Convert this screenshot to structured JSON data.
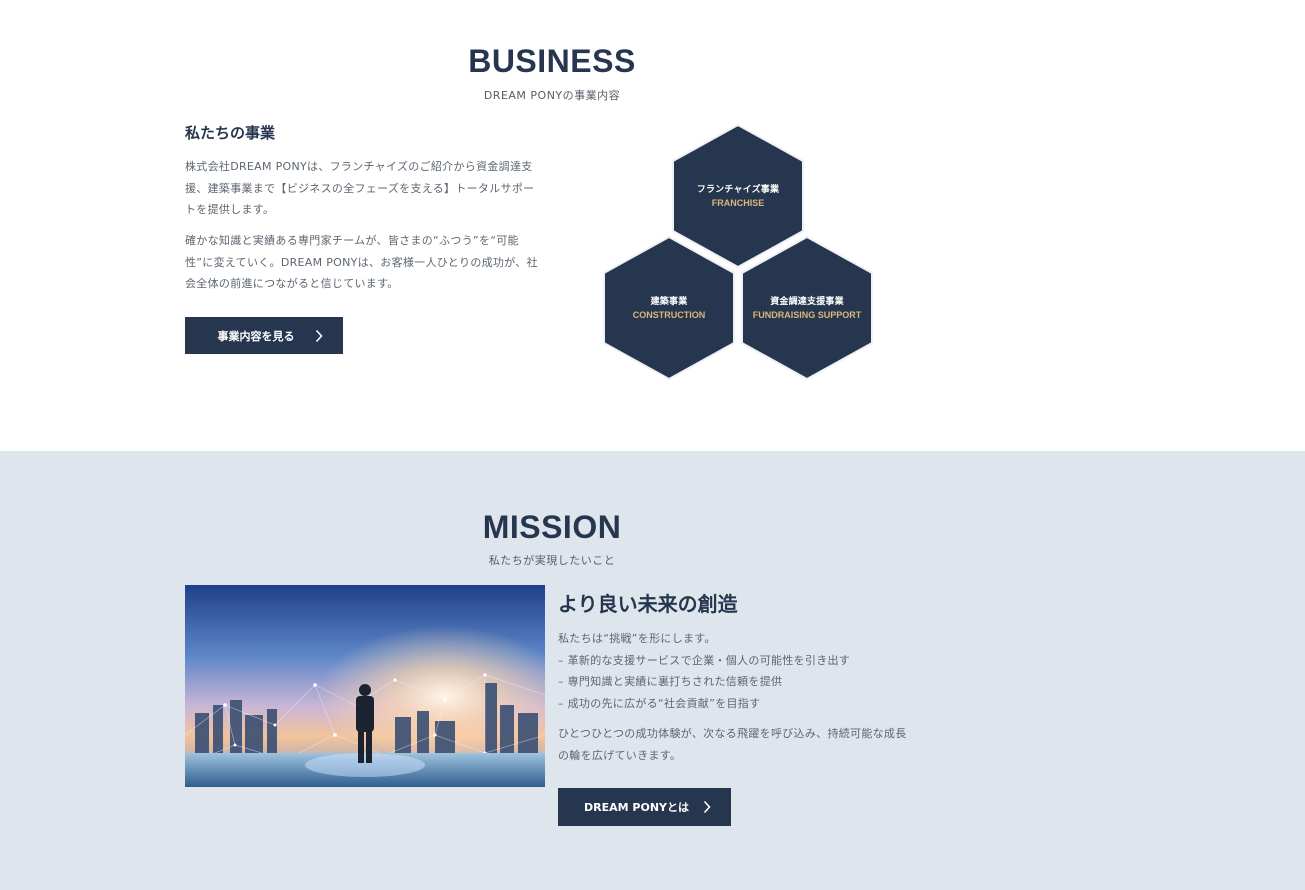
{
  "business": {
    "title": "BUSINESS",
    "subtitle": "DREAM PONYの事業内容",
    "heading": "私たちの事業",
    "paragraph1_lines": [
      "株式会社DREAM PONYは、フランチャイズのご紹介から資金調達支",
      "援、建築事業まで【ビジネスの全フェーズを支える】トータルサポー",
      "トを提供します。"
    ],
    "paragraph2_lines": [
      "確かな知識と実績ある専門家チームが、皆さまの“ふつう”を“可能",
      "性”に変えていく。DREAM PONYは、お客様一人ひとりの成功が、社",
      "会全体の前進につながると信じています。"
    ],
    "button_label": "事業内容を見る",
    "hexagons": [
      {
        "jp": "フランチャイズ事業",
        "en": "FRANCHISE"
      },
      {
        "jp": "建築事業",
        "en": "CONSTRUCTION"
      },
      {
        "jp": "資金調達支援事業",
        "en": "FUNDRAISING SUPPORT"
      }
    ]
  },
  "mission": {
    "title": "MISSION",
    "subtitle": "私たちが実現したいこと",
    "heading": "より良い未来の創造",
    "list_lines": [
      "私たちは“挑戦”を形にします。",
      "– 革新的な支援サービスで企業・個人の可能性を引き出す",
      "– 専門知識と実績に裏打ちされた信頼を提供",
      "– 成功の先に広がる“社会貢献”を目指す"
    ],
    "paragraph_lines": [
      "ひとつひとつの成功体験が、次なる飛躍を呼び込み、持続可能な成長",
      "の輪を広げていきます。"
    ],
    "button_label": "DREAM PONYとは"
  },
  "colors": {
    "navy": "#26364f",
    "gold": "#d9b77a",
    "mission_bg": "#dee5ed"
  }
}
